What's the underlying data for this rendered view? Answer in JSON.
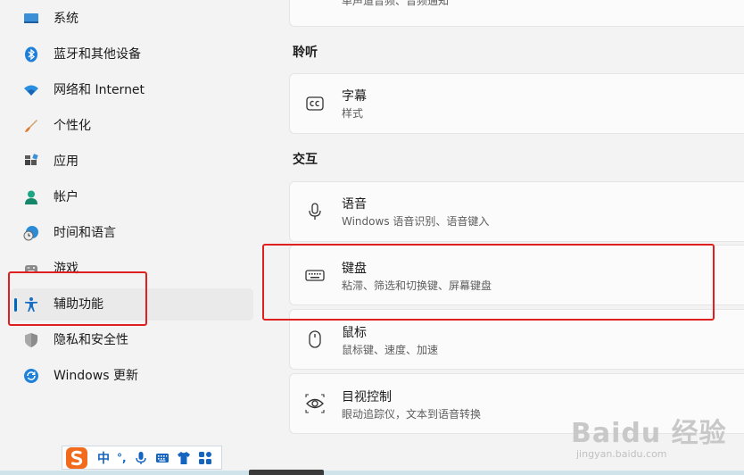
{
  "sidebar": {
    "items": [
      {
        "label": "系统",
        "icon": "monitor-icon"
      },
      {
        "label": "蓝牙和其他设备",
        "icon": "bluetooth-icon"
      },
      {
        "label": "网络和 Internet",
        "icon": "wifi-icon"
      },
      {
        "label": "个性化",
        "icon": "brush-icon"
      },
      {
        "label": "应用",
        "icon": "apps-icon"
      },
      {
        "label": "帐户",
        "icon": "account-icon"
      },
      {
        "label": "时间和语言",
        "icon": "clock-globe-icon"
      },
      {
        "label": "游戏",
        "icon": "gamepad-icon"
      },
      {
        "label": "辅助功能",
        "icon": "accessibility-icon",
        "active": true
      },
      {
        "label": "隐私和安全性",
        "icon": "shield-icon"
      },
      {
        "label": "Windows 更新",
        "icon": "update-icon"
      }
    ]
  },
  "main": {
    "top_card_sub": "单声道音频、音频通知",
    "sections": [
      {
        "heading": "聆听",
        "cards": [
          {
            "title": "字幕",
            "subtitle": "样式",
            "icon": "captions-icon"
          }
        ]
      },
      {
        "heading": "交互",
        "cards": [
          {
            "title": "语音",
            "subtitle": "Windows 语音识别、语音键入",
            "icon": "microphone-icon"
          },
          {
            "title": "键盘",
            "subtitle": "粘滞、筛选和切换键、屏幕键盘",
            "icon": "keyboard-icon"
          },
          {
            "title": "鼠标",
            "subtitle": "鼠标键、速度、加速",
            "icon": "mouse-icon"
          },
          {
            "title": "目视控制",
            "subtitle": "眼动追踪仪，文本到语音转换",
            "icon": "eye-control-icon"
          }
        ]
      }
    ]
  },
  "ime": {
    "mode": "中",
    "punct": "°,"
  },
  "watermark": {
    "main": "Baidu 经验",
    "sub": "jingyan.baidu.com"
  },
  "colors": {
    "accent": "#0067c0",
    "highlight_red": "#e02020",
    "ime_blue": "#1565c0"
  }
}
